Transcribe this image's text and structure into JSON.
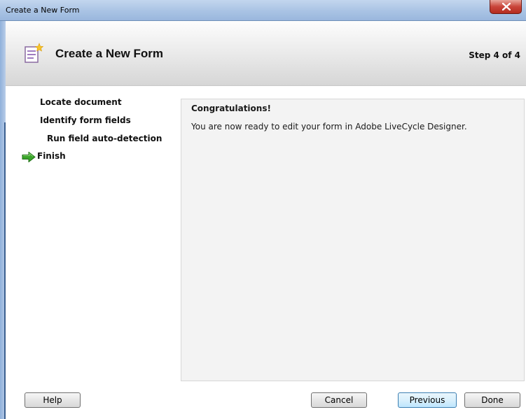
{
  "window": {
    "title": "Create a New Form",
    "close_icon": "close-icon"
  },
  "header": {
    "title": "Create a New Form",
    "step_indicator": "Step 4 of 4",
    "icon": "form-new-icon"
  },
  "steps": [
    {
      "label": "Locate document",
      "current": false
    },
    {
      "label": "Identify form fields",
      "current": false
    },
    {
      "label": "Run field auto-detection",
      "current": false
    },
    {
      "label": "Finish",
      "current": true
    }
  ],
  "current_step_icon": "green-arrow-icon",
  "panel": {
    "heading": "Congratulations!",
    "message": "You are now ready to edit your form in Adobe LiveCycle Designer."
  },
  "buttons": {
    "help": "Help",
    "cancel": "Cancel",
    "previous": "Previous",
    "done": "Done"
  },
  "colors": {
    "arrow_green": "#3aa52a",
    "close_red": "#c9453a",
    "titlebar_blue": "#a9c3e4"
  }
}
